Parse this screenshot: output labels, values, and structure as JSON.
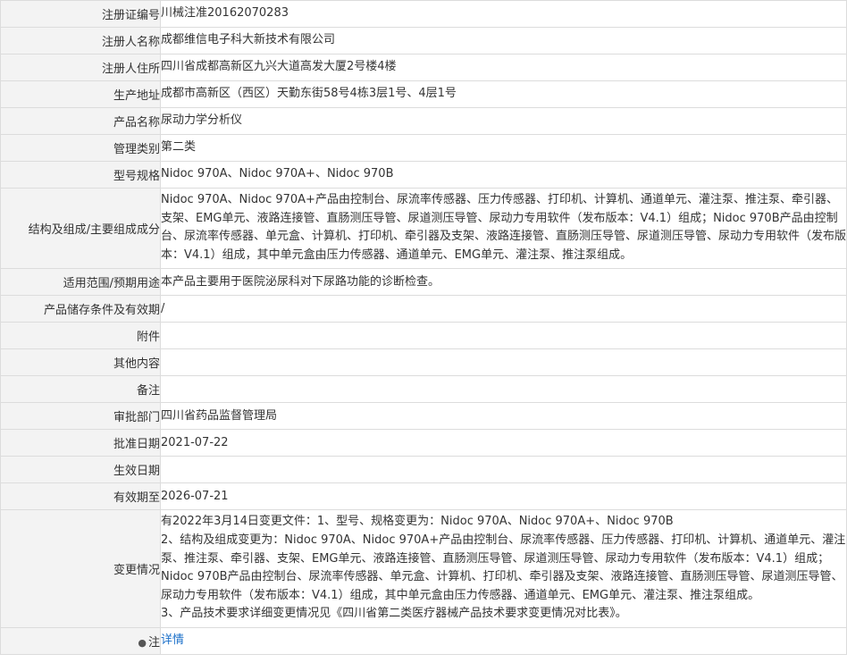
{
  "rows": [
    {
      "label": "注册证编号",
      "value": "川械注准20162070283"
    },
    {
      "label": "注册人名称",
      "value": "成都维信电子科大新技术有限公司"
    },
    {
      "label": "注册人住所",
      "value": "四川省成都高新区九兴大道高发大厦2号楼4楼"
    },
    {
      "label": "生产地址",
      "value": "成都市高新区（西区）天勤东街58号4栋3层1号、4层1号"
    },
    {
      "label": "产品名称",
      "value": "尿动力学分析仪"
    },
    {
      "label": "管理类别",
      "value": "第二类"
    },
    {
      "label": "型号规格",
      "value": "Nidoc 970A、Nidoc 970A+、Nidoc 970B"
    },
    {
      "label": "结构及组成/主要组成成分",
      "value": "Nidoc 970A、Nidoc 970A+产品由控制台、尿流率传感器、压力传感器、打印机、计算机、通道单元、灌注泵、推注泵、牵引器、支架、EMG单元、液路连接管、直肠测压导管、尿道测压导管、尿动力专用软件（发布版本：V4.1）组成；Nidoc 970B产品由控制台、尿流率传感器、单元盒、计算机、打印机、牵引器及支架、液路连接管、直肠测压导管、尿道测压导管、尿动力专用软件（发布版本：V4.1）组成，其中单元盒由压力传感器、通道单元、EMG单元、灌注泵、推注泵组成。"
    },
    {
      "label": "适用范围/预期用途",
      "value": "本产品主要用于医院泌尿科对下尿路功能的诊断检查。"
    },
    {
      "label": "产品储存条件及有效期",
      "value": "/"
    },
    {
      "label": "附件",
      "value": ""
    },
    {
      "label": "其他内容",
      "value": ""
    },
    {
      "label": "备注",
      "value": ""
    },
    {
      "label": "审批部门",
      "value": "四川省药品监督管理局"
    },
    {
      "label": "批准日期",
      "value": "2021-07-22"
    },
    {
      "label": "生效日期",
      "value": ""
    },
    {
      "label": "有效期至",
      "value": "2026-07-21"
    }
  ],
  "change": {
    "label": "变更情况",
    "lines": [
      "有2022年3月14日变更文件：1、型号、规格变更为：Nidoc 970A、Nidoc 970A+、Nidoc 970B",
      "2、结构及组成变更为：Nidoc 970A、Nidoc 970A+产品由控制台、尿流率传感器、压力传感器、打印机、计算机、通道单元、灌注泵、推注泵、牵引器、支架、EMG单元、液路连接管、直肠测压导管、尿道测压导管、尿动力专用软件（发布版本：V4.1）组成；Nidoc 970B产品由控制台、尿流率传感器、单元盒、计算机、打印机、牵引器及支架、液路连接管、直肠测压导管、尿道测压导管、尿动力专用软件（发布版本：V4.1）组成，其中单元盒由压力传感器、通道单元、EMG单元、灌注泵、推注泵组成。",
      "3、产品技术要求详细变更情况见《四川省第二类医疗器械产品技术要求变更情况对比表》。"
    ]
  },
  "note": {
    "label": "注",
    "icon": "lightbulb-icon",
    "link_text": "详情"
  }
}
